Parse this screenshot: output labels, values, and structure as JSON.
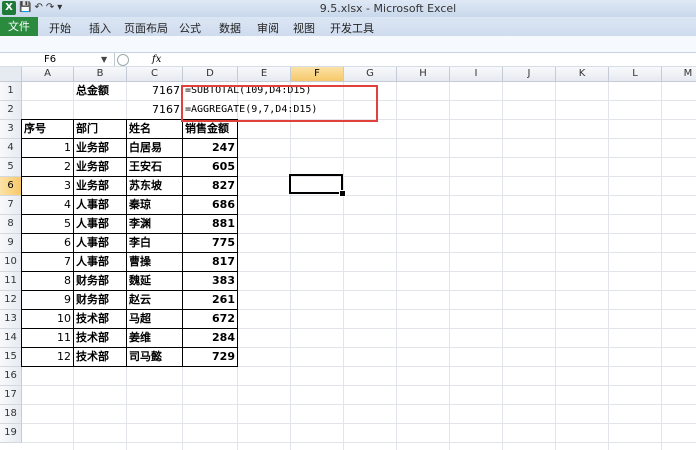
{
  "window": {
    "title": "9.5.xlsx - Microsoft Excel",
    "app_icon": "excel-icon"
  },
  "quick_access": {
    "save_icon": "save-icon",
    "undo_icon": "undo-icon",
    "redo_icon": "redo-icon",
    "customize_icon": "dropdown-icon"
  },
  "ribbon_tabs": [
    {
      "label": "文件"
    },
    {
      "label": "开始"
    },
    {
      "label": "插入"
    },
    {
      "label": "页面布局"
    },
    {
      "label": "公式"
    },
    {
      "label": "数据"
    },
    {
      "label": "审阅"
    },
    {
      "label": "视图"
    },
    {
      "label": "开发工具"
    }
  ],
  "formula_bar": {
    "name_box": "F6",
    "fx_label": "fx",
    "formula": ""
  },
  "columns": [
    "A",
    "B",
    "C",
    "D",
    "E",
    "F",
    "G",
    "H",
    "I",
    "J",
    "K",
    "L",
    "M"
  ],
  "rows": [
    "1",
    "2",
    "3",
    "4",
    "5",
    "6",
    "7",
    "8",
    "9",
    "10",
    "11",
    "12",
    "13",
    "14",
    "15",
    "16",
    "17",
    "18",
    "19"
  ],
  "active": {
    "column": "F",
    "row": "6"
  },
  "summary": {
    "label": "总金额",
    "value1": "7167",
    "value2": "7167",
    "formula1": "=SUBTOTAL(109,D4:D15)",
    "formula2": "=AGGREGATE(9,7,D4:D15)"
  },
  "table": {
    "headers": [
      "序号",
      "部门",
      "姓名",
      "销售金额"
    ],
    "rows": [
      [
        "1",
        "业务部",
        "白居易",
        "247"
      ],
      [
        "2",
        "业务部",
        "王安石",
        "605"
      ],
      [
        "3",
        "业务部",
        "苏东坡",
        "827"
      ],
      [
        "4",
        "人事部",
        "秦琼",
        "686"
      ],
      [
        "5",
        "人事部",
        "李渊",
        "881"
      ],
      [
        "6",
        "人事部",
        "李白",
        "775"
      ],
      [
        "7",
        "人事部",
        "曹操",
        "817"
      ],
      [
        "8",
        "财务部",
        "魏延",
        "383"
      ],
      [
        "9",
        "财务部",
        "赵云",
        "261"
      ],
      [
        "10",
        "技术部",
        "马超",
        "672"
      ],
      [
        "11",
        "技术部",
        "姜维",
        "284"
      ],
      [
        "12",
        "技术部",
        "司马懿",
        "729"
      ]
    ]
  },
  "colors": {
    "file_tab": "#2a8a3e",
    "highlight_border": "#e0413b",
    "active_header": "#f6c86a"
  }
}
